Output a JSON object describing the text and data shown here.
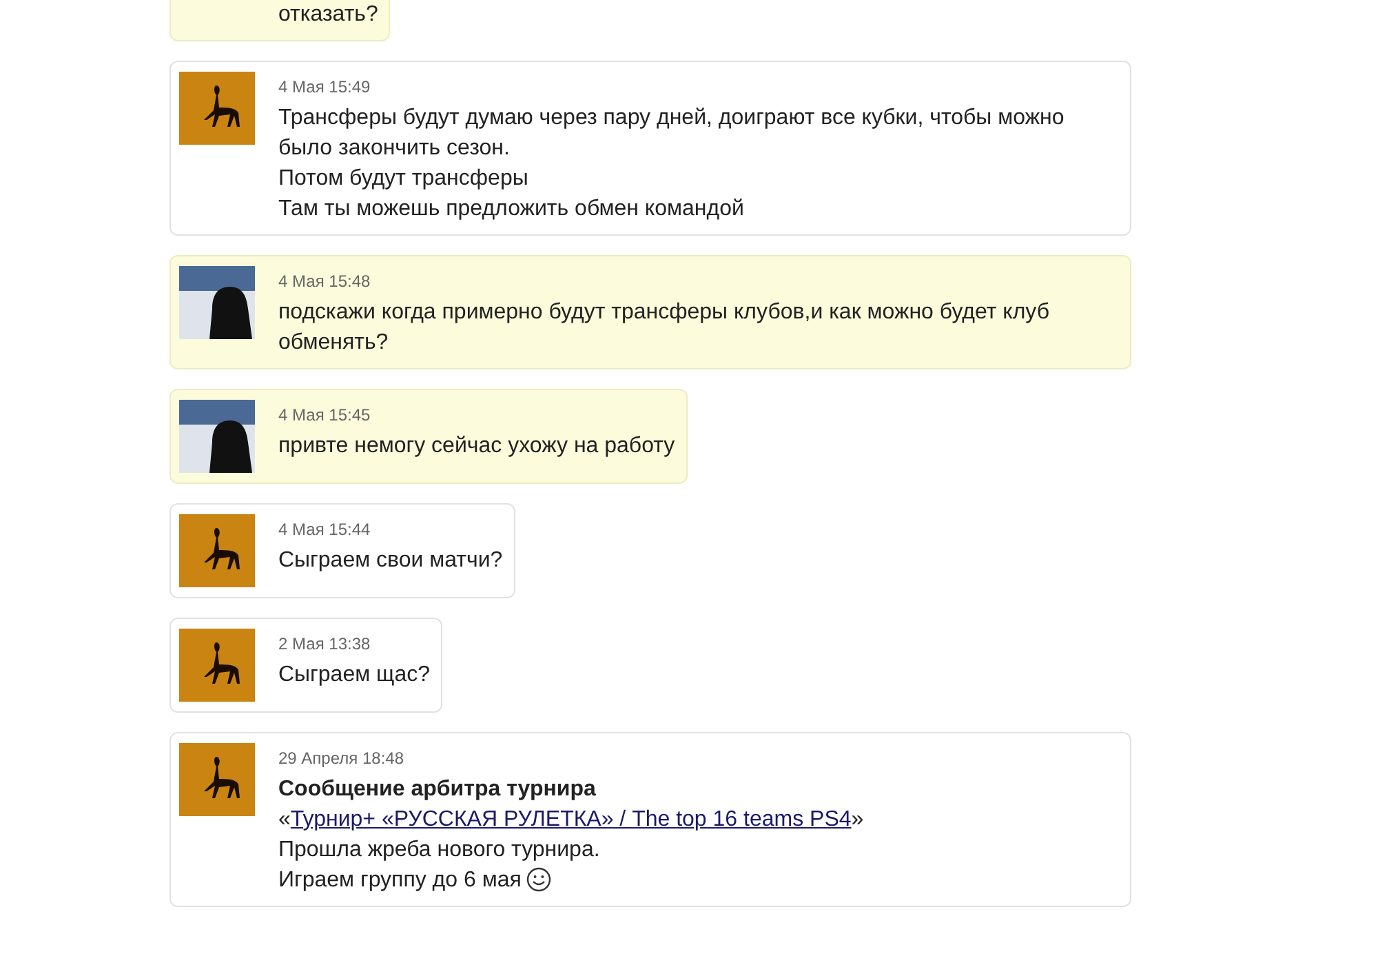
{
  "messages": [
    {
      "kind": "incoming",
      "lines": [
        {
          "kind": "text",
          "text": "отказать?"
        }
      ]
    },
    {
      "kind": "outgoing",
      "date": "4 Мая 15:49",
      "lines": [
        {
          "kind": "text",
          "text": "Трансферы будут думаю через пару дней, доиграют все кубки, чтобы можно было закончить сезон."
        },
        {
          "kind": "text",
          "text": "Потом будут трансферы"
        },
        {
          "kind": "text",
          "text": "Там ты можешь предложить обмен командой"
        }
      ]
    },
    {
      "kind": "incoming",
      "date": "4 Мая 15:48",
      "lines": [
        {
          "kind": "text",
          "text": "подскажи когда примерно будут трансферы клубов,и как можно будет клуб обменять?"
        }
      ]
    },
    {
      "kind": "incoming",
      "date": "4 Мая 15:45",
      "lines": [
        {
          "kind": "text",
          "text": "привте немогу сейчас ухожу на работу"
        }
      ]
    },
    {
      "kind": "outgoing",
      "date": "4 Мая 15:44",
      "lines": [
        {
          "kind": "text",
          "text": "Сыграем свои матчи?"
        }
      ]
    },
    {
      "kind": "outgoing",
      "date": "2 Мая 13:38",
      "lines": [
        {
          "kind": "text",
          "text": "Сыграем щас?"
        }
      ]
    },
    {
      "kind": "outgoing",
      "date": "29 Апреля 18:48",
      "lines": [
        {
          "kind": "notice",
          "lead": "Сообщение арбитра турнира",
          "before": "«",
          "link": "Турнир+ «РУССКАЯ РУЛЕТКА» / The top 16 teams PS4",
          "after": "»"
        },
        {
          "kind": "text",
          "text": "Прошла жреба нового турнира."
        },
        {
          "kind": "text",
          "text": "Играем группу до 6 мая",
          "smiley": true
        }
      ]
    }
  ]
}
